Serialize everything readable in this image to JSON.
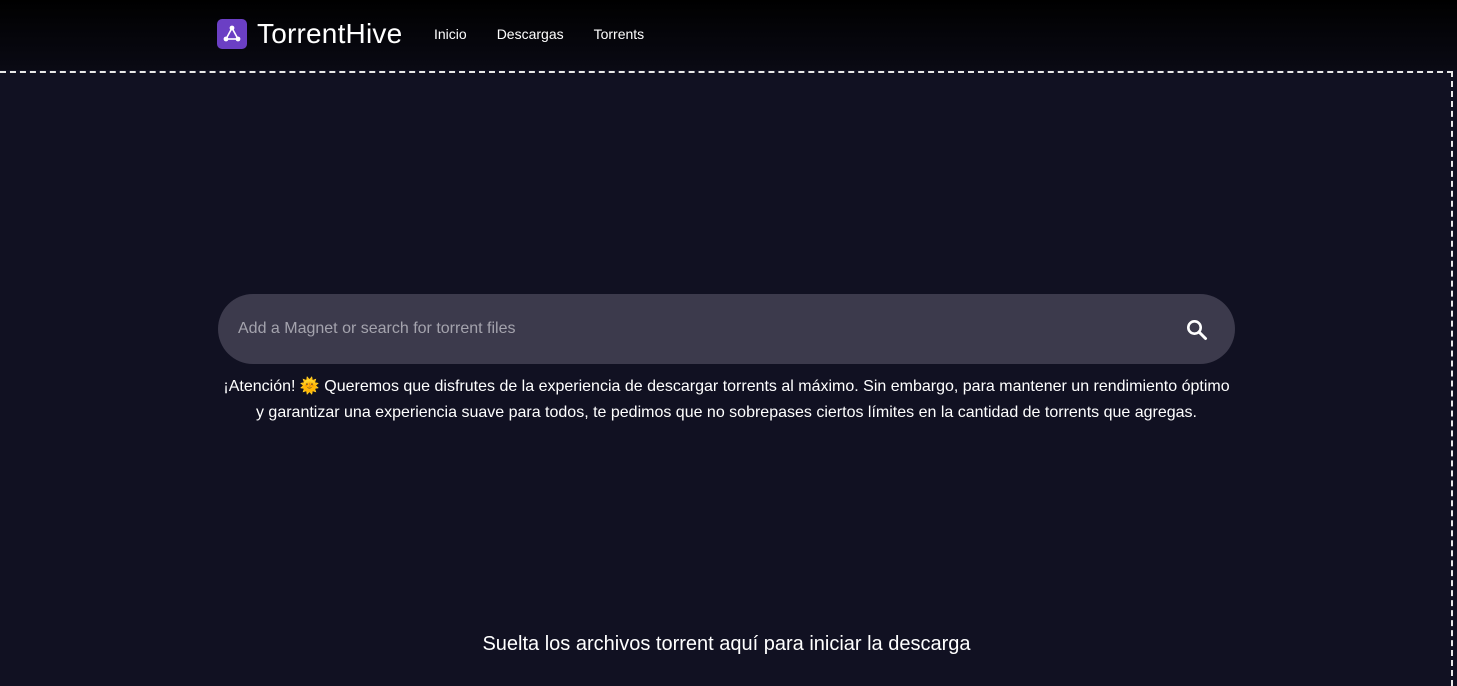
{
  "brand": {
    "name": "TorrentHive",
    "logo_icon": "share-nodes-icon",
    "accent_color": "#6b3fc4"
  },
  "nav": {
    "items": [
      {
        "label": "Inicio"
      },
      {
        "label": "Descargas"
      },
      {
        "label": "Torrents"
      }
    ]
  },
  "search": {
    "placeholder": "Add a Magnet or search for torrent files",
    "value": "",
    "icon": "search-icon"
  },
  "notice": {
    "text": "¡Atención! 🌞 Queremos que disfrutes de la experiencia de descargar torrents al máximo. Sin embargo, para mantener un rendimiento óptimo y garantizar una experiencia suave para todos, te pedimos que no sobrepases ciertos límites en la cantidad de torrents que agregas."
  },
  "dropzone": {
    "label": "Suelta los archivos torrent aquí para iniciar la descarga"
  },
  "colors": {
    "background": "#111122",
    "search_bg": "#3c3a4c"
  }
}
